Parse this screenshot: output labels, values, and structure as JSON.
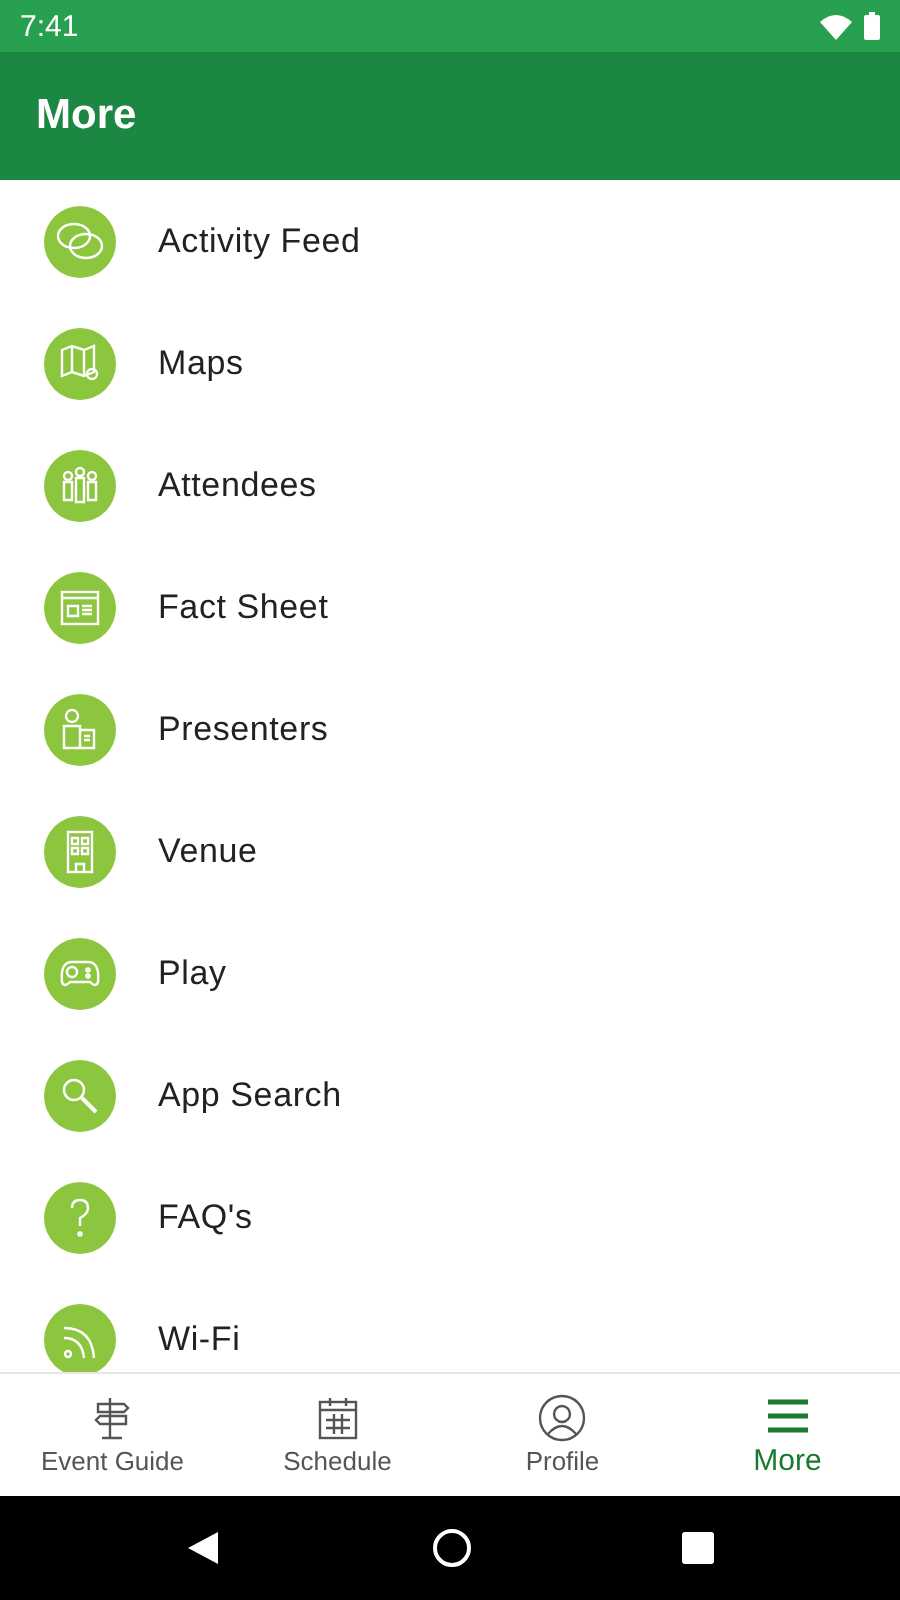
{
  "status_bar": {
    "time": "7:41"
  },
  "header": {
    "title": "More"
  },
  "menu_items": [
    {
      "label": "Activity Feed"
    },
    {
      "label": "Maps"
    },
    {
      "label": "Attendees"
    },
    {
      "label": "Fact Sheet"
    },
    {
      "label": "Presenters"
    },
    {
      "label": "Venue"
    },
    {
      "label": "Play"
    },
    {
      "label": "App Search"
    },
    {
      "label": "FAQ's"
    },
    {
      "label": "Wi-Fi"
    }
  ],
  "bottom_tabs": [
    {
      "label": "Event Guide",
      "selected": false
    },
    {
      "label": "Schedule",
      "selected": false
    },
    {
      "label": "Profile",
      "selected": false
    },
    {
      "label": "More",
      "selected": true
    }
  ]
}
